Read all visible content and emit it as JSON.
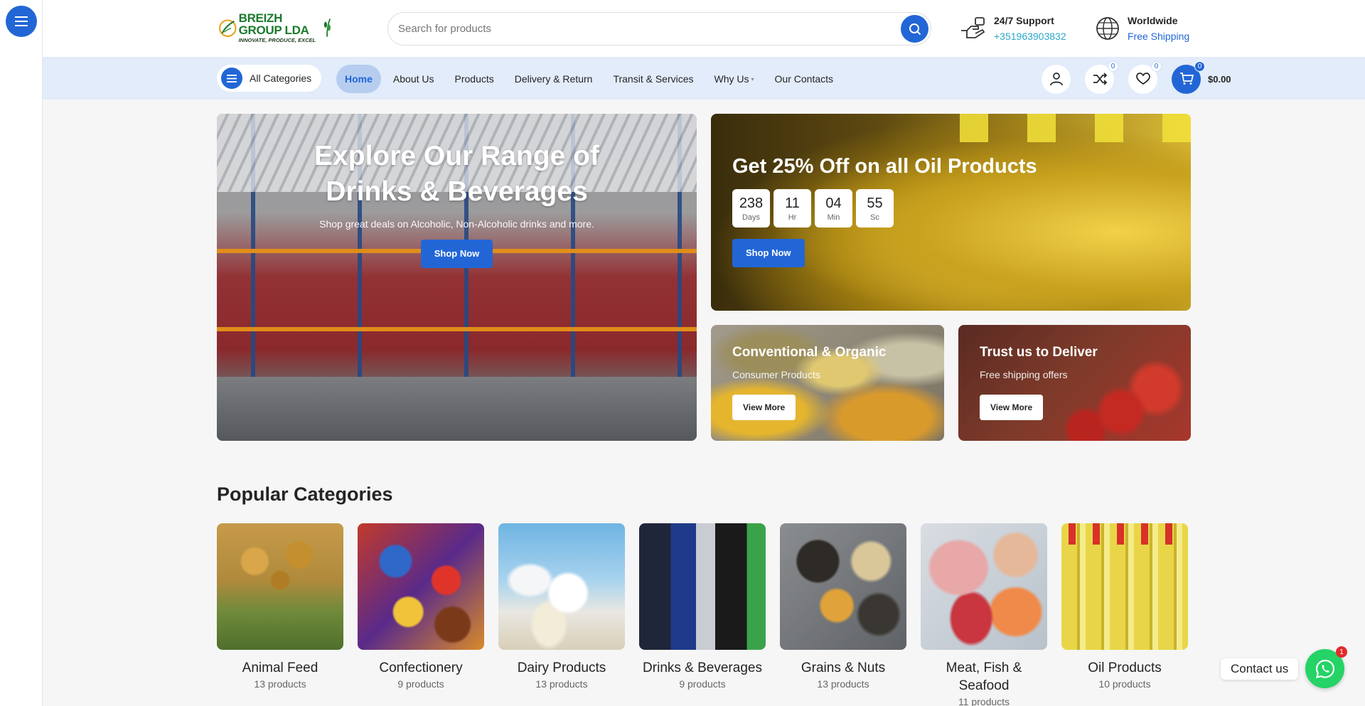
{
  "brand": {
    "name": "BREIZH GROUP LDA",
    "tagline": "INNOVATE, PRODUCE, EXCEL"
  },
  "search": {
    "placeholder": "Search for products"
  },
  "support": {
    "title": "24/7 Support",
    "phone": "+351963903832"
  },
  "shipping": {
    "title": "Worldwide",
    "subtitle": "Free Shipping"
  },
  "nav": {
    "all_categories": "All Categories",
    "items": [
      "Home",
      "About Us",
      "Products",
      "Delivery & Return",
      "Transit & Services",
      "Why Us",
      "Our Contacts"
    ],
    "active": "Home",
    "compare_count": "0",
    "wishlist_count": "0",
    "cart_count": "0",
    "cart_total": "$0.00"
  },
  "hero": {
    "main": {
      "title": "Explore Our Range of Drinks & Beverages",
      "subtitle": "Shop great deals on Alcoholic, Non-Alcoholic drinks and more.",
      "button": "Shop Now"
    },
    "oil": {
      "title": "Get 25% Off on all Oil Products",
      "timer": [
        {
          "value": "238",
          "label": "Days"
        },
        {
          "value": "11",
          "label": "Hr"
        },
        {
          "value": "04",
          "label": "Min"
        },
        {
          "value": "55",
          "label": "Sc"
        }
      ],
      "button": "Shop Now"
    },
    "organic": {
      "title": "Conventional & Organic",
      "subtitle": "Consumer Products",
      "button": "View More"
    },
    "deliver": {
      "title": "Trust us to Deliver",
      "subtitle": "Free shipping offers",
      "button": "View More"
    }
  },
  "categories": {
    "heading": "Popular Categories",
    "items": [
      {
        "name": "Animal Feed",
        "count": "13 products"
      },
      {
        "name": "Confectionery",
        "count": "9 products"
      },
      {
        "name": "Dairy Products",
        "count": "13 products"
      },
      {
        "name": "Drinks & Beverages",
        "count": "9 products"
      },
      {
        "name": "Grains & Nuts",
        "count": "13 products"
      },
      {
        "name": "Meat, Fish & Seafood",
        "count": "11 products"
      },
      {
        "name": "Oil Products",
        "count": "10 products"
      }
    ]
  },
  "contact": {
    "label": "Contact us",
    "badge": "1"
  },
  "colors": {
    "accent": "#2266d6",
    "nav_bg": "#e2ecfa",
    "whatsapp": "#25d366",
    "support_link": "#2aa7c8"
  }
}
